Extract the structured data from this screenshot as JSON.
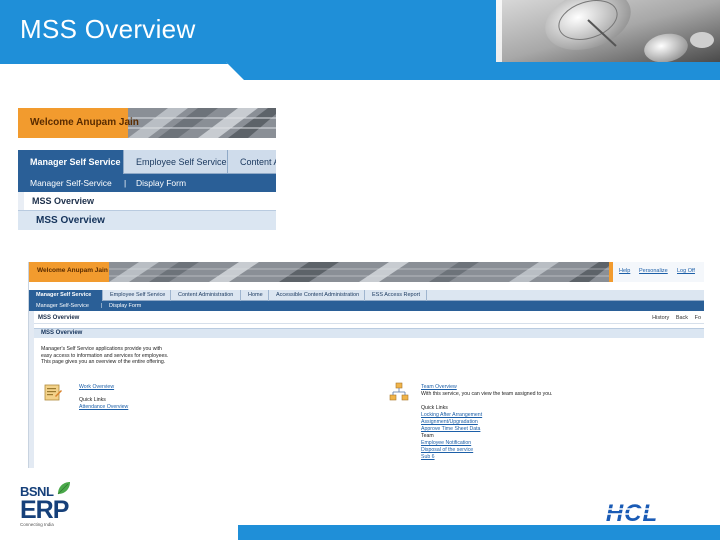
{
  "slide": {
    "title": "MSS Overview"
  },
  "colors": {
    "header_blue": "#1f8fd8",
    "portal_orange": "#f29b2e",
    "portal_navy": "#2a5f97",
    "hcl_blue": "#1a5bb5"
  },
  "zoom_crop": {
    "welcome": "Welcome Anupam Jain",
    "tabs": [
      "Manager Self Service",
      "Employee Self Service",
      "Content Ac"
    ],
    "active_tab": 0,
    "subnav": [
      "Manager Self-Service",
      "|",
      "Display Form"
    ],
    "breadcrumb": "MSS Overview",
    "section_title": "MSS Overview"
  },
  "portal": {
    "welcome": "Welcome Anupam Jain",
    "top_links": [
      "Help",
      "Personalize",
      "Log Off"
    ],
    "tabs": [
      "Manager Self Service",
      "Employee Self Service",
      "Content Administration",
      "Home",
      "Accessible Content Administration",
      "ESS Access Report"
    ],
    "active_tab": 0,
    "subnav": [
      "Manager Self-Service",
      "|",
      "Display Form"
    ],
    "breadcrumb": "MSS Overview",
    "history_links": [
      "History",
      "Back",
      "Fo"
    ],
    "section_title": "MSS Overview",
    "intro_lines": [
      "Manager's Self Service applications provide you with",
      "easy access to information and services for employees.",
      "This page gives you an overview of the entire offering."
    ],
    "work_overview": {
      "title": "Work Overview",
      "quick_links_label": "Quick Links",
      "links": [
        "Attendance Overview"
      ]
    },
    "team_overview": {
      "title": "Team Overview",
      "description": "With this service, you can view the team assigned to you.",
      "quick_links_label": "Quick Links",
      "links": [
        "Locking After Arrangement",
        "Assignment/Upgradation",
        "Approve Time Sheet Data"
      ],
      "team_label": "Team",
      "team_links": [
        "Employee Notification",
        "Disposal of the service",
        "Sub 6"
      ]
    }
  },
  "footer": {
    "bsnl": "BSNL",
    "erp": "ERP",
    "erp_tagline": "Connecting India",
    "hcl": "HCL"
  }
}
